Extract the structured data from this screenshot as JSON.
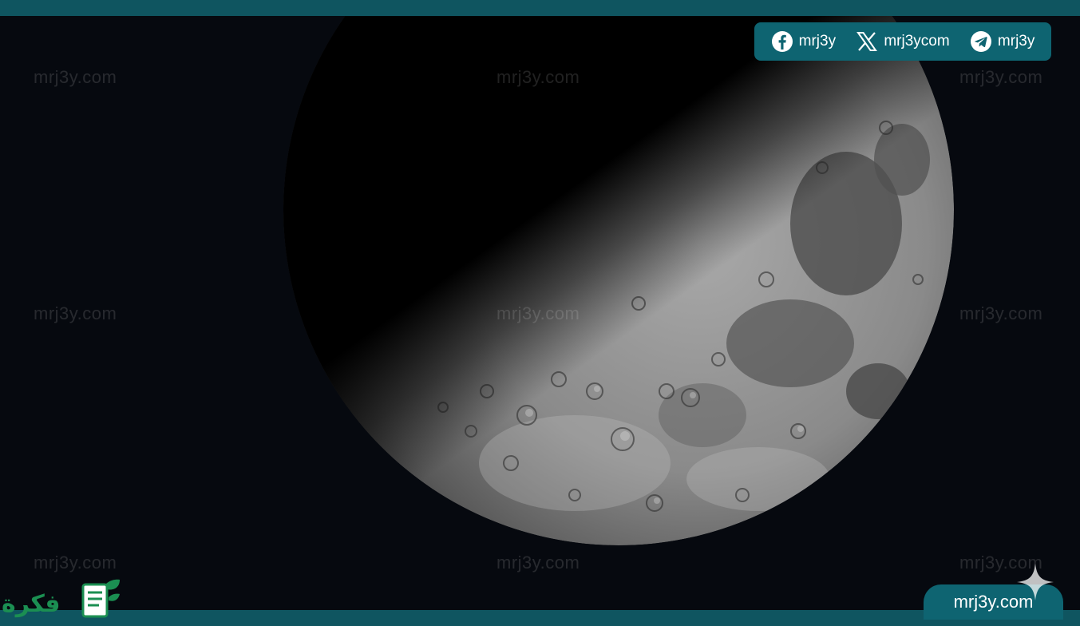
{
  "watermarks": {
    "text": "mrj3y.com"
  },
  "social": {
    "facebook": {
      "icon": "facebook-icon",
      "handle": "mrj3y"
    },
    "x": {
      "icon": "x-icon",
      "handle": "mrj3ycom"
    },
    "telegram": {
      "icon": "telegram-icon",
      "handle": "mrj3y"
    }
  },
  "site_badge": {
    "text": "mrj3y.com"
  },
  "logo": {
    "text": "فكرة",
    "icon": "document-leaf-logo"
  },
  "colors": {
    "brand_teal": "#0e6471",
    "frame_bar": "#0f5560",
    "sky": "#06090f",
    "logo_green": "#1b8f52"
  }
}
